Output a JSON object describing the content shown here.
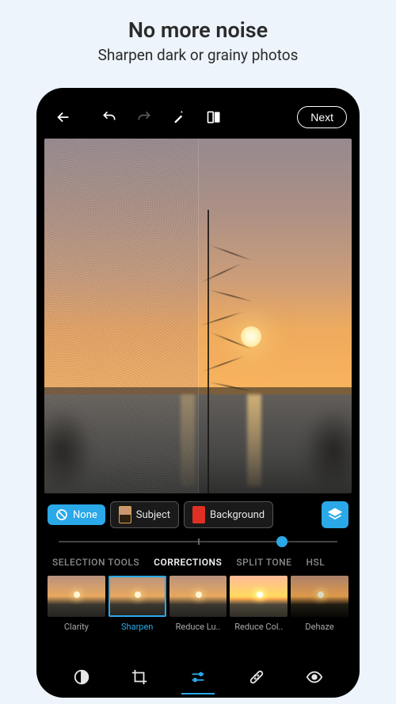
{
  "promo": {
    "title": "No more noise",
    "subtitle": "Sharpen dark or grainy photos"
  },
  "topbar": {
    "next_label": "Next"
  },
  "mask": {
    "none_label": "None",
    "subject_label": "Subject",
    "background_label": "Background"
  },
  "categories": {
    "items": [
      "SELECTION TOOLS",
      "CORRECTIONS",
      "SPLIT TONE",
      "HSL"
    ],
    "active_index": 1
  },
  "filters": {
    "items": [
      {
        "label": "Clarity"
      },
      {
        "label": "Sharpen"
      },
      {
        "label": "Reduce Lu.."
      },
      {
        "label": "Reduce Col.."
      },
      {
        "label": "Dehaze"
      }
    ],
    "active_index": 1
  },
  "slider": {
    "value_percent": 80
  },
  "bottom_nav": {
    "active_index": 2
  },
  "colors": {
    "accent": "#2aa8e8"
  }
}
